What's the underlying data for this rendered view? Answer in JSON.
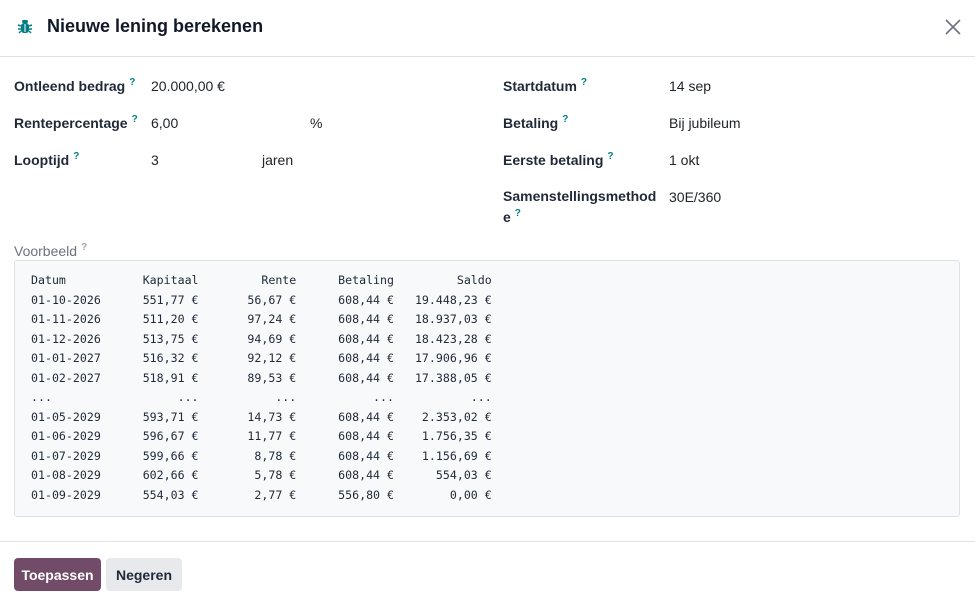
{
  "dialog": {
    "title": "Nieuwe lening berekenen",
    "icon": "bug-icon",
    "close_icon": "close-icon"
  },
  "tooltip_mark": "?",
  "left_fields": {
    "amount": {
      "label": "Ontleend bedrag",
      "value": "20.000,00 €"
    },
    "rate": {
      "label": "Rentepercentage",
      "value": "6,00",
      "unit": "%"
    },
    "term": {
      "label": "Looptijd",
      "value": "3",
      "unit": "jaren"
    }
  },
  "right_fields": {
    "start": {
      "label": "Startdatum",
      "value": "14 sep"
    },
    "payment": {
      "label": "Betaling",
      "value": "Bij jubileum"
    },
    "first_payment": {
      "label": "Eerste betaling",
      "value": "1 okt"
    },
    "compounding": {
      "label_line1": "Samenstellingsmethod",
      "label_line2": "e",
      "value": "30E/360"
    }
  },
  "preview": {
    "label": "Voorbeeld",
    "columns": [
      "Datum",
      "Kapitaal",
      "Rente",
      "Betaling",
      "Saldo"
    ],
    "rows": [
      [
        "01-10-2026",
        "551,77 €",
        "56,67 €",
        "608,44 €",
        "19.448,23 €"
      ],
      [
        "01-11-2026",
        "511,20 €",
        "97,24 €",
        "608,44 €",
        "18.937,03 €"
      ],
      [
        "01-12-2026",
        "513,75 €",
        "94,69 €",
        "608,44 €",
        "18.423,28 €"
      ],
      [
        "01-01-2027",
        "516,32 €",
        "92,12 €",
        "608,44 €",
        "17.906,96 €"
      ],
      [
        "01-02-2027",
        "518,91 €",
        "89,53 €",
        "608,44 €",
        "17.388,05 €"
      ],
      [
        "...",
        "...",
        "...",
        "...",
        "..."
      ],
      [
        "01-05-2029",
        "593,71 €",
        "14,73 €",
        "608,44 €",
        "2.353,02 €"
      ],
      [
        "01-06-2029",
        "596,67 €",
        "11,77 €",
        "608,44 €",
        "1.756,35 €"
      ],
      [
        "01-07-2029",
        "599,66 €",
        "8,78 €",
        "608,44 €",
        "1.156,69 €"
      ],
      [
        "01-08-2029",
        "602,66 €",
        "5,78 €",
        "608,44 €",
        "554,03 €"
      ],
      [
        "01-09-2029",
        "554,03 €",
        "2,77 €",
        "556,80 €",
        "0,00 €"
      ]
    ]
  },
  "buttons": {
    "apply": "Toepassen",
    "discard": "Negeren"
  },
  "colors": {
    "primary": "#714b67",
    "tooltip": "#017e84",
    "secondary_button": "#e7e9ed"
  }
}
